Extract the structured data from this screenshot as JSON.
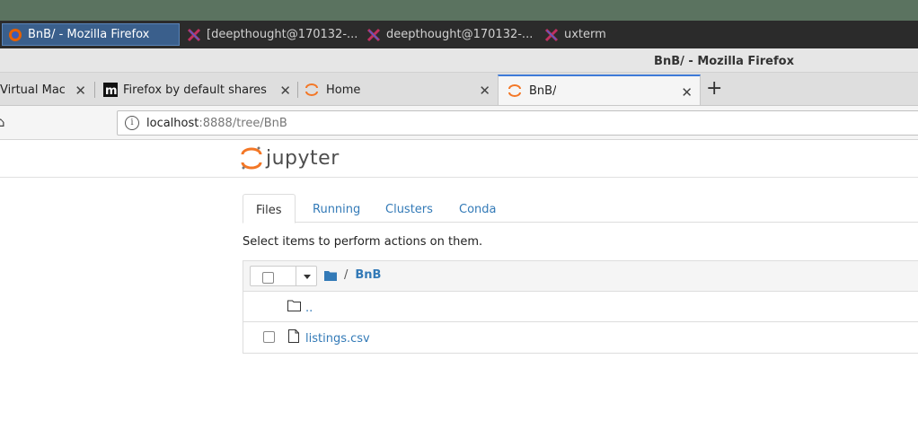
{
  "taskbar": {
    "items": [
      {
        "label": "BnB/ - Mozilla Firefox",
        "active": true
      },
      {
        "label": "[deepthought@170132-...",
        "active": false
      },
      {
        "label": "deepthought@170132-...",
        "active": false
      },
      {
        "label": "uxterm",
        "active": false
      }
    ]
  },
  "window": {
    "title": "BnB/ - Mozilla Firefox"
  },
  "browser_tabs": [
    {
      "label": "Virtual Mac"
    },
    {
      "label": "Firefox by default shares"
    },
    {
      "label": "Home"
    },
    {
      "label": "BnB/"
    }
  ],
  "urlbar": {
    "host": "localhost",
    "path": ":8888/tree/BnB"
  },
  "jupyter": {
    "logo_text": "jupyter",
    "tabs": [
      {
        "label": "Files"
      },
      {
        "label": "Running"
      },
      {
        "label": "Clusters"
      },
      {
        "label": "Conda"
      }
    ],
    "hint": "Select items to perform actions on them.",
    "breadcrumb": {
      "separator": "/",
      "dir": "BnB"
    },
    "entries": [
      {
        "name": "..",
        "type": "folder"
      },
      {
        "name": "listings.csv",
        "type": "file"
      }
    ]
  },
  "colors": {
    "link": "#337ab7",
    "accent": "#f37726",
    "tab_selected": "#3d7ad8"
  }
}
